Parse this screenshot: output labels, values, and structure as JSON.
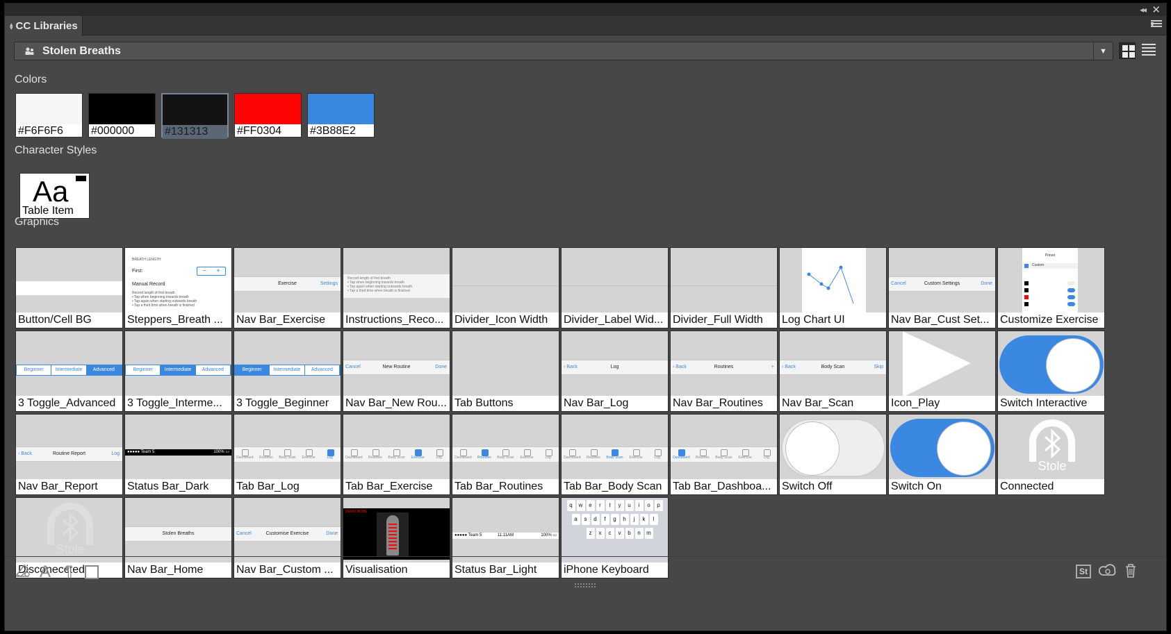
{
  "panel": {
    "tab_label": "CC Libraries",
    "library_name": "Stolen Breaths"
  },
  "sections": {
    "colors": "Colors",
    "character_styles": "Character Styles",
    "graphics": "Graphics"
  },
  "colors": [
    {
      "hex": "#F6F6F6",
      "value": "#F6F6F6"
    },
    {
      "hex": "#000000",
      "value": "#000000"
    },
    {
      "hex": "#131313",
      "value": "#131313",
      "selected": true
    },
    {
      "hex": "#FF0304",
      "value": "#FF0304"
    },
    {
      "hex": "#3B88E2",
      "value": "#3B88E2"
    }
  ],
  "character_styles": [
    {
      "preview": "Aa",
      "name": "Table Item"
    }
  ],
  "graphics": [
    {
      "name": "Button/Cell BG"
    },
    {
      "name": "Steppers_Breath ..."
    },
    {
      "name": "Nav Bar_Exercise"
    },
    {
      "name": "Instructions_Reco..."
    },
    {
      "name": "Divider_Icon Width"
    },
    {
      "name": "Divider_Label Wid..."
    },
    {
      "name": "Divider_Full Width"
    },
    {
      "name": "Log Chart UI"
    },
    {
      "name": "Nav Bar_Cust Set..."
    },
    {
      "name": "Customize Exercise"
    },
    {
      "name": "3 Toggle_Advanced"
    },
    {
      "name": "3 Toggle_Interme..."
    },
    {
      "name": "3 Toggle_Beginner"
    },
    {
      "name": "Nav Bar_New Rou..."
    },
    {
      "name": "Tab Buttons"
    },
    {
      "name": "Nav Bar_Log"
    },
    {
      "name": "Nav Bar_Routines"
    },
    {
      "name": "Nav Bar_Scan"
    },
    {
      "name": "Icon_Play"
    },
    {
      "name": "Switch Interactive"
    },
    {
      "name": "Nav Bar_Report"
    },
    {
      "name": "Status Bar_Dark"
    },
    {
      "name": "Tab Bar_Log"
    },
    {
      "name": "Tab Bar_Exercise"
    },
    {
      "name": "Tab Bar_Routines"
    },
    {
      "name": "Tab Bar_Body Scan"
    },
    {
      "name": "Tab Bar_Dashboa..."
    },
    {
      "name": "Switch Off"
    },
    {
      "name": "Switch On"
    },
    {
      "name": "Connected"
    },
    {
      "name": "Disconeccted"
    },
    {
      "name": "Nav Bar_Home"
    },
    {
      "name": "Nav Bar_Custom ..."
    },
    {
      "name": "Visualisation"
    },
    {
      "name": "Status Bar_Light"
    },
    {
      "name": "iPhone Keyboard"
    }
  ],
  "thumb_text": {
    "breath_length": "BREATH LENGTH",
    "first": "First:",
    "manual_record": "Manual Record",
    "record_note": "Record length of first breath",
    "tip1": "• Tap when beginning inwards breath",
    "tip2": "• Tap again when starting outwards breath",
    "tip3": "• Tap a third time when breath is finished",
    "exercise": "Exercise",
    "settings": "Settings",
    "cancel": "Cancel",
    "custom_settings": "Custom Settings",
    "done": "Done",
    "beginner": "Beginner",
    "intermediate": "Intermediate",
    "advanced": "Advanced",
    "new_routine": "New Routine",
    "back": "Back",
    "log": "Log",
    "routines": "Routines",
    "body_scan": "Body Scan",
    "skip": "Skip",
    "routine_report": "Routine Report",
    "stolen_breaths": "Stolen Breaths",
    "customise_exercise": "Customise Exercise",
    "stole": "Stole",
    "preset": "Preset",
    "custom": "Custom",
    "team": "Team 5",
    "time": "11:11AM",
    "battery": "100%",
    "tabs": [
      "Dashboard",
      "Routines",
      "Body Scan",
      "Exercise",
      "Log"
    ],
    "kb_row1": [
      "q",
      "w",
      "e",
      "r",
      "t",
      "y",
      "u",
      "i",
      "o",
      "p"
    ],
    "kb_row2": [
      "a",
      "s",
      "d",
      "f",
      "g",
      "h",
      "j",
      "k",
      "l"
    ],
    "kb_row3": [
      "z",
      "x",
      "c",
      "v",
      "b",
      "n",
      "m"
    ]
  },
  "footer": {
    "stock_label": "St"
  }
}
